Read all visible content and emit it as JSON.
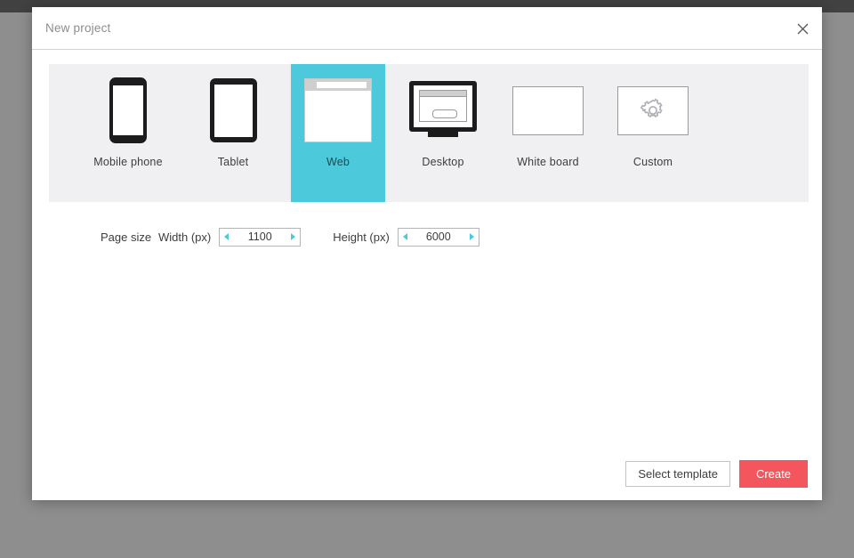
{
  "window": {
    "topbar_color": "#414141",
    "backdrop_color": "#8e8e8e"
  },
  "dialog": {
    "title": "New project",
    "close_icon": "close-icon",
    "accent_color": "#4cc9db",
    "divider_color": "#b9dde2"
  },
  "templates": {
    "panel_background": "#f0eff2",
    "items": [
      {
        "id": "mobile-phone",
        "label": "Mobile phone",
        "art": "phone-icon",
        "selected": false
      },
      {
        "id": "tablet",
        "label": "Tablet",
        "art": "tablet-icon",
        "selected": false
      },
      {
        "id": "web",
        "label": "Web",
        "art": "browser-icon",
        "selected": true
      },
      {
        "id": "desktop",
        "label": "Desktop",
        "art": "monitor-icon",
        "selected": false
      },
      {
        "id": "white-board",
        "label": "White board",
        "art": "blank-page-icon",
        "selected": false
      },
      {
        "id": "custom",
        "label": "Custom",
        "art": "gear-icon",
        "selected": false
      }
    ]
  },
  "page_size": {
    "label": "Page size",
    "width": {
      "label": "Width (px)",
      "value": "1100",
      "dec_icon": "arrow-left-icon",
      "inc_icon": "arrow-right-icon"
    },
    "height": {
      "label": "Height (px)",
      "value": "6000",
      "dec_icon": "arrow-left-icon",
      "inc_icon": "arrow-right-icon"
    }
  },
  "footer": {
    "select_template_label": "Select template",
    "create_label": "Create",
    "create_color": "#f4565e"
  }
}
